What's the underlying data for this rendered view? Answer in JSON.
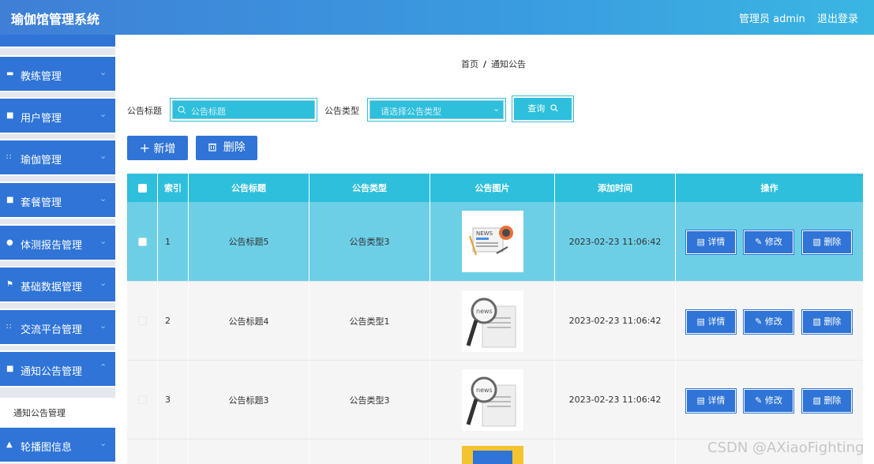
{
  "header": {
    "title": "瑜伽馆管理系统",
    "admin": "管理员 admin",
    "logout": "退出登录"
  },
  "sidebar": {
    "items": [
      {
        "label": "",
        "icon": "partial-item"
      },
      {
        "label": "教练管理",
        "icon": "coach-icon"
      },
      {
        "label": "用户管理",
        "icon": "user-icon"
      },
      {
        "label": "瑜伽管理",
        "icon": "grid-icon"
      },
      {
        "label": "套餐管理",
        "icon": "package-icon"
      },
      {
        "label": "体测报告管理",
        "icon": "person-icon"
      },
      {
        "label": "基础数据管理",
        "icon": "flag-icon"
      },
      {
        "label": "交流平台管理",
        "icon": "grid-icon"
      },
      {
        "label": "通知公告管理",
        "icon": "notice-icon"
      },
      {
        "label": "轮播图信息",
        "icon": "carousel-icon"
      }
    ],
    "submenu": "通知公告管理"
  },
  "breadcrumb": {
    "home": "首页",
    "sep": "/",
    "current": "通知公告"
  },
  "search": {
    "title_label": "公告标题",
    "title_placeholder": "公告标题",
    "type_label": "公告类型",
    "type_placeholder": "请选择公告类型",
    "query_button": "查询"
  },
  "toolbar": {
    "add": "新增",
    "delete": "删除"
  },
  "table": {
    "headers": [
      "",
      "索引",
      "公告标题",
      "公告类型",
      "公告图片",
      "添加时间",
      "操作"
    ],
    "rows": [
      {
        "index": "1",
        "title": "公告标题5",
        "type": "公告类型3",
        "time": "2023-02-23 11:06:42",
        "image": "news-flat-icon"
      },
      {
        "index": "2",
        "title": "公告标题4",
        "type": "公告类型1",
        "time": "2023-02-23 11:06:42",
        "image": "news-magnifier-icon"
      },
      {
        "index": "3",
        "title": "公告标题3",
        "type": "公告类型3",
        "time": "2023-02-23 11:06:42",
        "image": "news-magnifier-icon"
      }
    ],
    "actions": {
      "detail": "详情",
      "edit": "修改",
      "delete": "删除"
    }
  },
  "watermark": "CSDN @AXiaoFighting",
  "colors": {
    "primary": "#2f74d6",
    "accent": "#2ebfdc",
    "selected_row": "#6dcfe6"
  }
}
